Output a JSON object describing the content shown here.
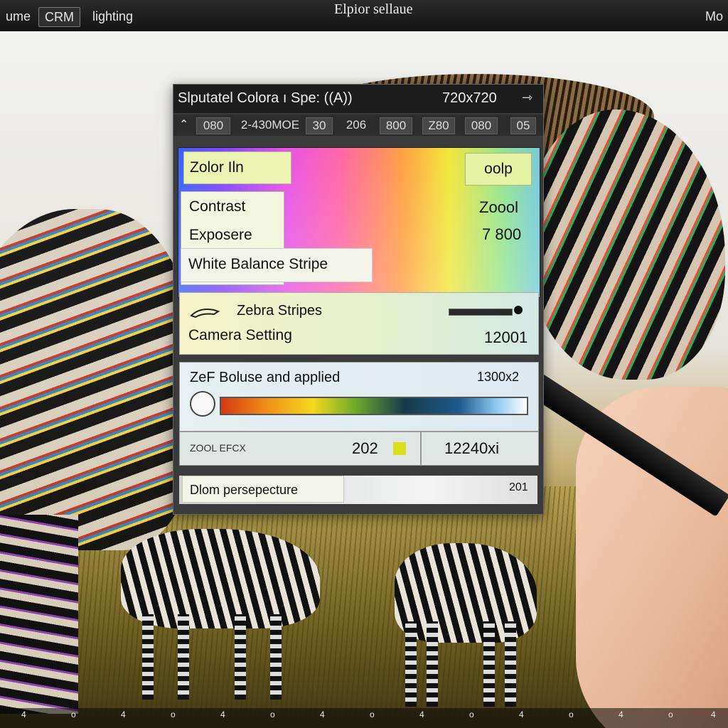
{
  "topbar": {
    "tabs": [
      "ume",
      "CRM",
      "lighting"
    ],
    "title": "Elpior sellaue",
    "right_tab": "Mo"
  },
  "panel": {
    "title": "Slputatel Colora ı Spe: ((A))",
    "size": "720x720",
    "arrow": "⇾",
    "toolbar": [
      "080",
      "2-430MOE",
      "30",
      "206",
      "800",
      "Z80",
      "080",
      "05"
    ],
    "color_label": "Zolor Iln",
    "color_value": "oolp",
    "contrast_label": "Contrast",
    "contrast_value": "Zoool",
    "exposure_label": "Exposere",
    "exposure_value": "7 800",
    "white_balance_label": "White Balance Stripe",
    "zebra_label": "Zebra Stripes",
    "camera_label": "Camera  Setting",
    "camera_value": "12001",
    "apply_label": "ZeF Boluse and applied",
    "apply_value": "1300x2",
    "efx_label": "ZOOL EFCX",
    "efx_value": "202",
    "efx_right_value": "12240xi",
    "perspective_label": "Dlom persepecture",
    "perspective_value": "201"
  },
  "bottom_ticks": [
    "4",
    "o",
    "4",
    "o",
    "4",
    "o",
    "4",
    "o",
    "4",
    "o",
    "4",
    "o",
    "4",
    "o",
    "4"
  ],
  "colors": {
    "panel_bg": "#3b3b3b",
    "label_bg": "#eaf3b2",
    "spectrum_start": "#2b59ff",
    "spectrum_end": "#6fc8d8"
  }
}
